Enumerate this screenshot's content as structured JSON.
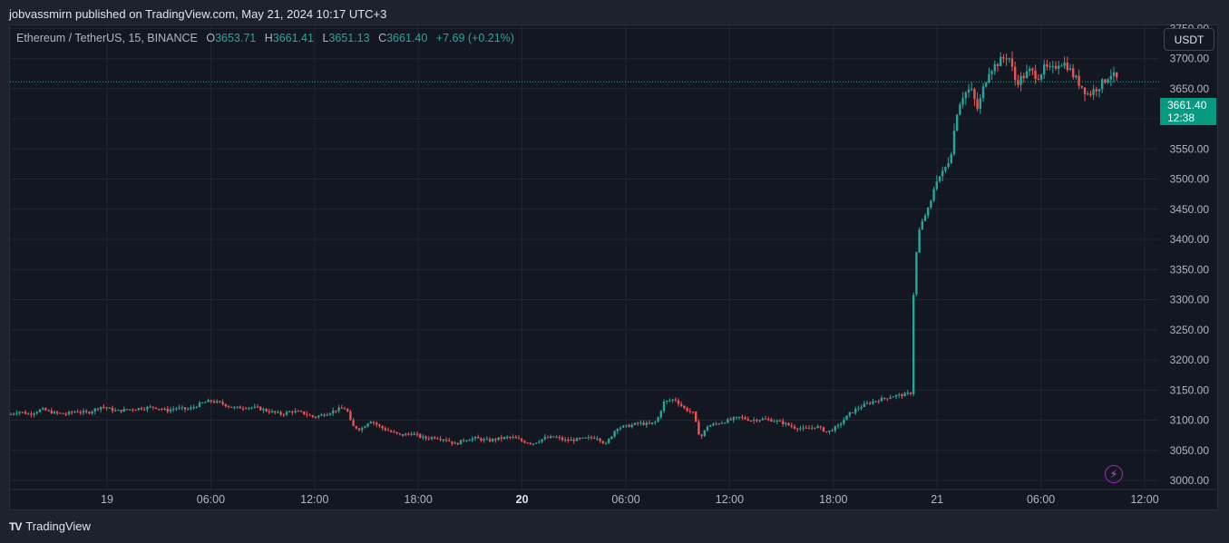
{
  "header": {
    "publish_line": "jobvassmirn published on TradingView.com, May 21, 2024 10:17 UTC+3"
  },
  "legend": {
    "symbol": "Ethereum / TetherUS, 15, BINANCE",
    "o_label": "O",
    "o_value": "3653.71",
    "h_label": "H",
    "h_value": "3661.41",
    "l_label": "L",
    "l_value": "3651.13",
    "c_label": "C",
    "c_value": "3661.40",
    "change": "+7.69 (+0.21%)"
  },
  "currency_button": "USDT",
  "last_price": {
    "price": "3661.40",
    "countdown": "12:38"
  },
  "footer": {
    "logo_text": "TV",
    "brand": "TradingView"
  },
  "colors": {
    "up": "#26a69a",
    "down": "#ef5350",
    "grid": "#232632",
    "axis_text": "#b2b5be",
    "price_tag": "#089981"
  },
  "icons": {
    "alert": "lightning-icon"
  },
  "chart_data": {
    "type": "candlestick",
    "y_ticks": [
      "3000.00",
      "3050.00",
      "3100.00",
      "3150.00",
      "3200.00",
      "3250.00",
      "3300.00",
      "3350.00",
      "3400.00",
      "3450.00",
      "3500.00",
      "3550.00",
      "3600.00",
      "3650.00",
      "3700.00",
      "3750.00"
    ],
    "x_ticks": [
      {
        "label": "19",
        "bold": false
      },
      {
        "label": "06:00",
        "bold": false
      },
      {
        "label": "12:00",
        "bold": false
      },
      {
        "label": "18:00",
        "bold": false
      },
      {
        "label": "20",
        "bold": true
      },
      {
        "label": "06:00",
        "bold": false
      },
      {
        "label": "12:00",
        "bold": false
      },
      {
        "label": "18:00",
        "bold": false
      },
      {
        "label": "21",
        "bold": false
      },
      {
        "label": "06:00",
        "bold": false
      },
      {
        "label": "12:00",
        "bold": false
      }
    ],
    "ylim": [
      2985,
      3755
    ],
    "close_path": [
      [
        0,
        3110
      ],
      [
        8,
        3115
      ],
      [
        20,
        3110
      ],
      [
        34,
        3118
      ],
      [
        48,
        3112
      ],
      [
        60,
        3110
      ],
      [
        72,
        3115
      ],
      [
        84,
        3112
      ],
      [
        100,
        3123
      ],
      [
        116,
        3115
      ],
      [
        130,
        3118
      ],
      [
        144,
        3120
      ],
      [
        158,
        3122
      ],
      [
        172,
        3116
      ],
      [
        182,
        3120
      ],
      [
        196,
        3118
      ],
      [
        210,
        3128
      ],
      [
        220,
        3132
      ],
      [
        232,
        3128
      ],
      [
        246,
        3120
      ],
      [
        260,
        3122
      ],
      [
        272,
        3120
      ],
      [
        284,
        3115
      ],
      [
        298,
        3110
      ],
      [
        310,
        3115
      ],
      [
        322,
        3112
      ],
      [
        334,
        3105
      ],
      [
        346,
        3110
      ],
      [
        360,
        3118
      ],
      [
        370,
        3120
      ],
      [
        376,
        3090
      ],
      [
        386,
        3085
      ],
      [
        396,
        3100
      ],
      [
        408,
        3088
      ],
      [
        420,
        3080
      ],
      [
        430,
        3075
      ],
      [
        442,
        3078
      ],
      [
        456,
        3070
      ],
      [
        468,
        3072
      ],
      [
        480,
        3068
      ],
      [
        490,
        3060
      ],
      [
        500,
        3068
      ],
      [
        512,
        3070
      ],
      [
        526,
        3066
      ],
      [
        540,
        3070
      ],
      [
        552,
        3072
      ],
      [
        564,
        3065
      ],
      [
        576,
        3062
      ],
      [
        588,
        3070
      ],
      [
        600,
        3072
      ],
      [
        612,
        3066
      ],
      [
        624,
        3068
      ],
      [
        636,
        3070
      ],
      [
        646,
        3072
      ],
      [
        656,
        3060
      ],
      [
        668,
        3088
      ],
      [
        680,
        3090
      ],
      [
        692,
        3095
      ],
      [
        704,
        3093
      ],
      [
        712,
        3098
      ],
      [
        720,
        3130
      ],
      [
        732,
        3135
      ],
      [
        742,
        3120
      ],
      [
        752,
        3112
      ],
      [
        760,
        3070
      ],
      [
        768,
        3090
      ],
      [
        780,
        3095
      ],
      [
        792,
        3100
      ],
      [
        804,
        3105
      ],
      [
        816,
        3100
      ],
      [
        828,
        3102
      ],
      [
        840,
        3100
      ],
      [
        852,
        3095
      ],
      [
        864,
        3088
      ],
      [
        876,
        3085
      ],
      [
        888,
        3090
      ],
      [
        900,
        3080
      ],
      [
        912,
        3090
      ],
      [
        924,
        3110
      ],
      [
        936,
        3122
      ],
      [
        948,
        3130
      ],
      [
        960,
        3135
      ],
      [
        972,
        3140
      ],
      [
        984,
        3142
      ],
      [
        992,
        3145
      ],
      [
        996,
        3350
      ],
      [
        1002,
        3420
      ],
      [
        1008,
        3440
      ],
      [
        1014,
        3460
      ],
      [
        1020,
        3500
      ],
      [
        1028,
        3510
      ],
      [
        1036,
        3540
      ],
      [
        1044,
        3620
      ],
      [
        1050,
        3640
      ],
      [
        1058,
        3650
      ],
      [
        1066,
        3615
      ],
      [
        1072,
        3650
      ],
      [
        1078,
        3680
      ],
      [
        1086,
        3690
      ],
      [
        1094,
        3700
      ],
      [
        1100,
        3705
      ],
      [
        1108,
        3660
      ],
      [
        1116,
        3670
      ],
      [
        1124,
        3680
      ],
      [
        1132,
        3670
      ],
      [
        1140,
        3685
      ],
      [
        1148,
        3680
      ],
      [
        1156,
        3695
      ],
      [
        1164,
        3690
      ],
      [
        1172,
        3670
      ],
      [
        1180,
        3655
      ],
      [
        1188,
        3640
      ],
      [
        1196,
        3650
      ],
      [
        1204,
        3660
      ],
      [
        1212,
        3675
      ],
      [
        1218,
        3668
      ],
      [
        1222,
        3661
      ]
    ]
  }
}
